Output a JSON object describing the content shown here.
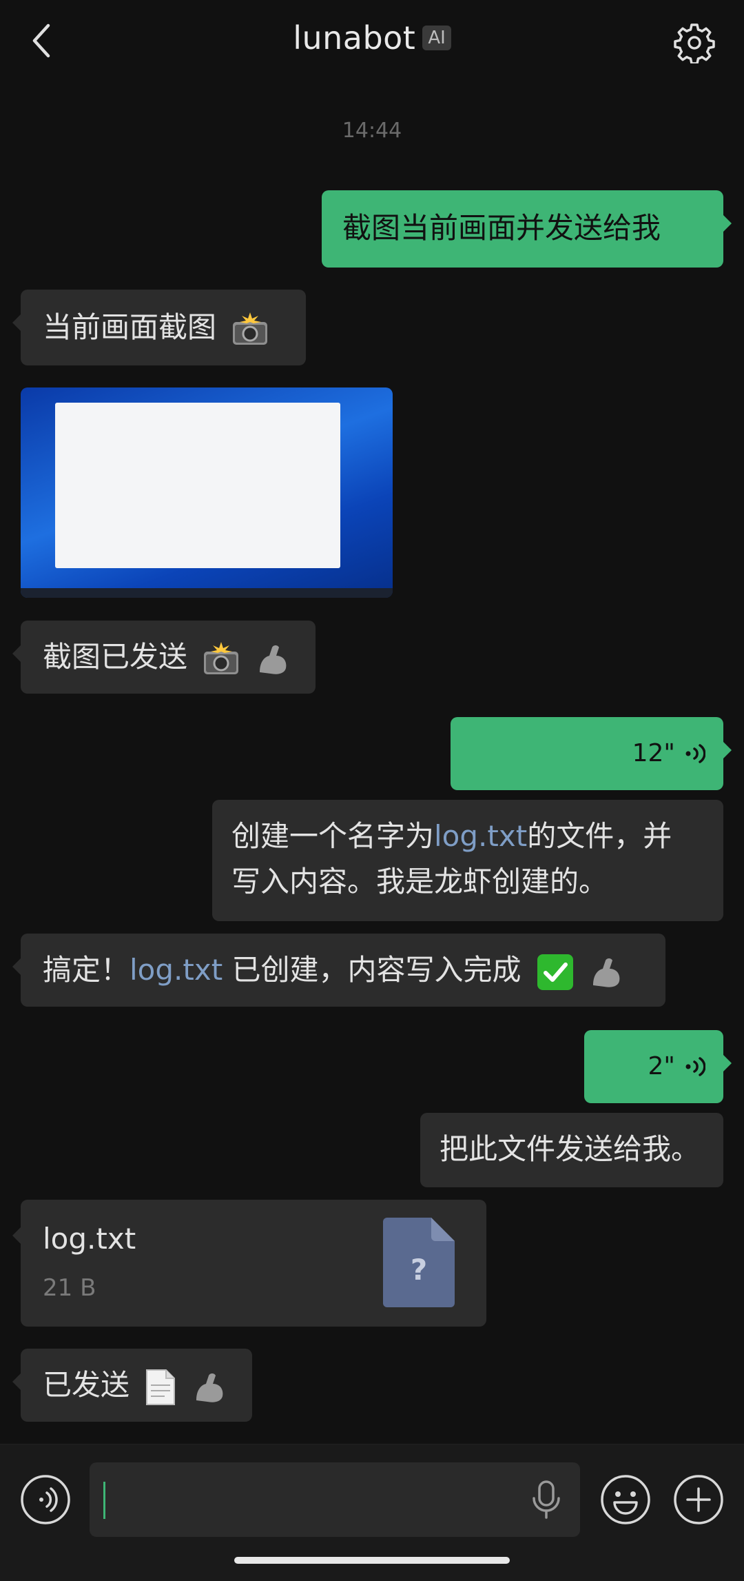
{
  "header": {
    "title": "lunabot",
    "badge": "AI"
  },
  "timestamp": "14:44",
  "messages": {
    "m1": "截图当前画面并发送给我",
    "m2": "当前画面截图",
    "m3": "截图已发送",
    "voice1": "12\"",
    "m4a": "创建一个名字为",
    "m4_link": "log.txt",
    "m4b": "的文件，并",
    "m4c": "写入内容。我是龙虾创建的。",
    "m5a": "搞定！",
    "m5_link": "log.txt",
    "m5b": " 已创建，内容写入完成",
    "voice2": "2\"",
    "m6": "把此文件发送给我。",
    "m7": "已发送"
  },
  "file": {
    "name": "log.txt",
    "size": "21 B",
    "icon_glyph": "?"
  },
  "colors": {
    "background": "#111111",
    "bubble_in": "#2c2c2c",
    "bubble_out": "#3eb575",
    "link": "#7f9ec6"
  }
}
